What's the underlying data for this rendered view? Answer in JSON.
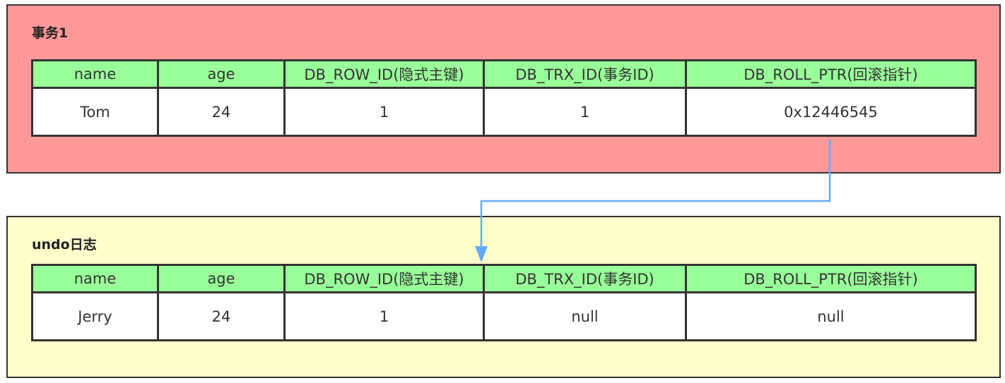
{
  "transaction": {
    "title": "事务1",
    "background": "#ff9999",
    "headers": [
      "name",
      "age",
      "DB_ROW_ID(隐式主键)",
      "DB_TRX_ID(事务ID)",
      "DB_ROLL_PTR(回滚指针)"
    ],
    "values": [
      "Tom",
      "24",
      "1",
      "1",
      "0x12446545"
    ]
  },
  "undo_log": {
    "title": "undo日志",
    "background": "#ffffcc",
    "headers": [
      "name",
      "age",
      "DB_ROW_ID(隐式主键)",
      "DB_TRX_ID(事务ID)",
      "DB_ROLL_PTR(回滚指针)"
    ],
    "values": [
      "Jerry",
      "24",
      "1",
      "null",
      "null"
    ]
  },
  "colors": {
    "header_fill": "#99ff99",
    "arrow": "#66aaff",
    "border": "#333333"
  }
}
